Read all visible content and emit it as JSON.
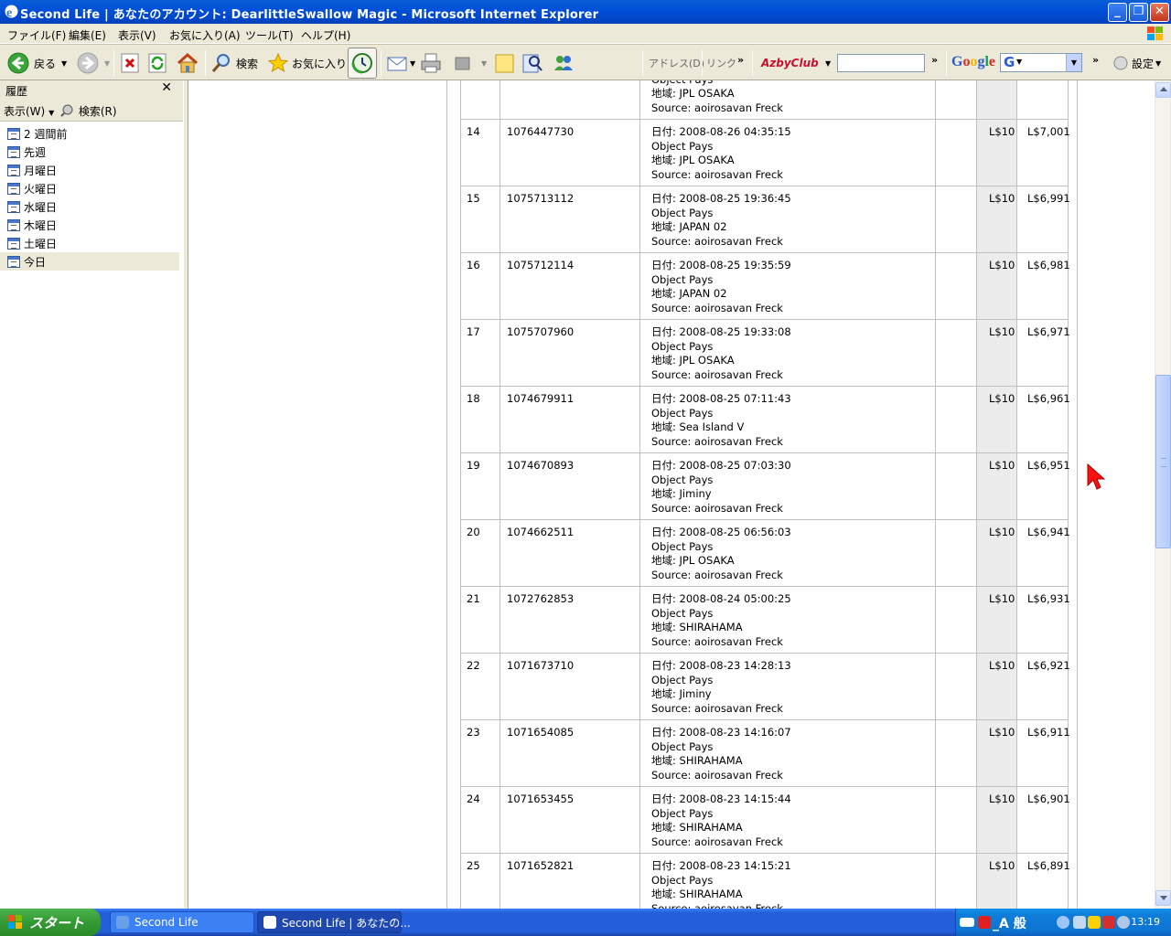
{
  "window": {
    "title": "Second Life | あなたのアカウント: DearlittleSwallow Magic - Microsoft Internet Explorer"
  },
  "menu": [
    "ファイル(F)",
    "編集(E)",
    "表示(V)",
    "お気に入り(A)",
    "ツール(T)",
    "ヘルプ(H)"
  ],
  "toolbar": {
    "back": "戻る",
    "search": "検索",
    "favorites": "お気に入り",
    "address": "アドレス(D)",
    "links": "リンク",
    "azby": "AzbyClub",
    "google": "Google",
    "google_select": "G",
    "settings": "設定"
  },
  "history": {
    "title": "履歴",
    "view": "表示(W)",
    "search": "検索(R)",
    "items": [
      {
        "label": "2 週間前"
      },
      {
        "label": "先週"
      },
      {
        "label": "月曜日"
      },
      {
        "label": "火曜日"
      },
      {
        "label": "水曜日"
      },
      {
        "label": "木曜日"
      },
      {
        "label": "土曜日"
      },
      {
        "label": "今日",
        "selected": true
      }
    ]
  },
  "transactions": {
    "date_prefix": "日付: ",
    "region_prefix": "地域: ",
    "source_prefix": "Source: ",
    "rows": [
      {
        "num": "",
        "id": "",
        "date": "",
        "type": "Object Pays",
        "region": "JPL OSAKA",
        "source": "aoirosavan Freck",
        "amount": "",
        "balance": ""
      },
      {
        "num": "14",
        "id": "1076447730",
        "date": "2008-08-26 04:35:15",
        "type": "Object Pays",
        "region": "JPL OSAKA",
        "source": "aoirosavan Freck",
        "amount": "L$10",
        "balance": "L$7,001"
      },
      {
        "num": "15",
        "id": "1075713112",
        "date": "2008-08-25 19:36:45",
        "type": "Object Pays",
        "region": "JAPAN 02",
        "source": "aoirosavan Freck",
        "amount": "L$10",
        "balance": "L$6,991"
      },
      {
        "num": "16",
        "id": "1075712114",
        "date": "2008-08-25 19:35:59",
        "type": "Object Pays",
        "region": "JAPAN 02",
        "source": "aoirosavan Freck",
        "amount": "L$10",
        "balance": "L$6,981"
      },
      {
        "num": "17",
        "id": "1075707960",
        "date": "2008-08-25 19:33:08",
        "type": "Object Pays",
        "region": "JPL OSAKA",
        "source": "aoirosavan Freck",
        "amount": "L$10",
        "balance": "L$6,971"
      },
      {
        "num": "18",
        "id": "1074679911",
        "date": "2008-08-25 07:11:43",
        "type": "Object Pays",
        "region": "Sea Island V",
        "source": "aoirosavan Freck",
        "amount": "L$10",
        "balance": "L$6,961"
      },
      {
        "num": "19",
        "id": "1074670893",
        "date": "2008-08-25 07:03:30",
        "type": "Object Pays",
        "region": "Jiminy",
        "source": "aoirosavan Freck",
        "amount": "L$10",
        "balance": "L$6,951"
      },
      {
        "num": "20",
        "id": "1074662511",
        "date": "2008-08-25 06:56:03",
        "type": "Object Pays",
        "region": "JPL OSAKA",
        "source": "aoirosavan Freck",
        "amount": "L$10",
        "balance": "L$6,941"
      },
      {
        "num": "21",
        "id": "1072762853",
        "date": "2008-08-24 05:00:25",
        "type": "Object Pays",
        "region": "SHIRAHAMA",
        "source": "aoirosavan Freck",
        "amount": "L$10",
        "balance": "L$6,931"
      },
      {
        "num": "22",
        "id": "1071673710",
        "date": "2008-08-23 14:28:13",
        "type": "Object Pays",
        "region": "Jiminy",
        "source": "aoirosavan Freck",
        "amount": "L$10",
        "balance": "L$6,921"
      },
      {
        "num": "23",
        "id": "1071654085",
        "date": "2008-08-23 14:16:07",
        "type": "Object Pays",
        "region": "SHIRAHAMA",
        "source": "aoirosavan Freck",
        "amount": "L$10",
        "balance": "L$6,911"
      },
      {
        "num": "24",
        "id": "1071653455",
        "date": "2008-08-23 14:15:44",
        "type": "Object Pays",
        "region": "SHIRAHAMA",
        "source": "aoirosavan Freck",
        "amount": "L$10",
        "balance": "L$6,901"
      },
      {
        "num": "25",
        "id": "1071652821",
        "date": "2008-08-23 14:15:21",
        "type": "Object Pays",
        "region": "SHIRAHAMA",
        "source": "aoirosavan Freck",
        "amount": "L$10",
        "balance": "L$6,891"
      }
    ]
  },
  "taskbar": {
    "start": "スタート",
    "tasks": [
      {
        "label": "Second Life",
        "active": false
      },
      {
        "label": "Second Life | あなたの...",
        "active": true
      }
    ],
    "ime": "_A 般",
    "clock": "13:19"
  }
}
